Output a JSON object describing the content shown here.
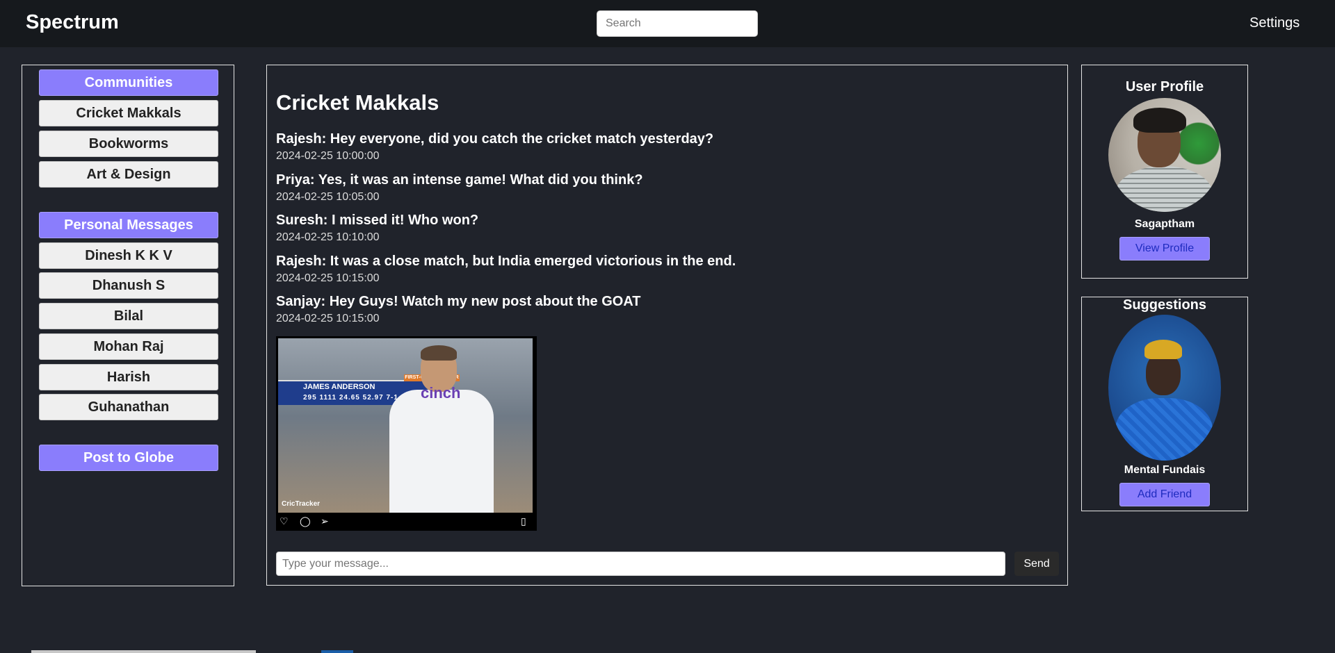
{
  "app": {
    "title": "Spectrum",
    "settings_label": "Settings"
  },
  "search": {
    "placeholder": "Search"
  },
  "sidebar": {
    "communities_label": "Communities",
    "communities": [
      "Cricket Makkals",
      "Bookworms",
      "Art & Design"
    ],
    "personal_label": "Personal Messages",
    "contacts": [
      "Dinesh K K V",
      "Dhanush S",
      "Bilal",
      "Mohan Raj",
      "Harish",
      "Guhanathan"
    ],
    "post_label": "Post to Globe"
  },
  "chat": {
    "title": "Cricket Makkals",
    "messages": [
      {
        "text": "Rajesh: Hey everyone, did you catch the cricket match yesterday?",
        "time": "2024-02-25 10:00:00"
      },
      {
        "text": "Priya: Yes, it was an intense game! What did you think?",
        "time": "2024-02-25 10:05:00"
      },
      {
        "text": "Suresh: I missed it! Who won?",
        "time": "2024-02-25 10:10:00"
      },
      {
        "text": "Rajesh: It was a close match, but India emerged victorious in the end.",
        "time": "2024-02-25 10:15:00"
      },
      {
        "text": "Sanjay: Hey Guys! Watch my new post about the GOAT",
        "time": "2024-02-25 10:15:00"
      }
    ],
    "post_image": {
      "scoreboard_name": "JAMES ANDERSON",
      "scoreboard_tag": "FIRST-CLASS CAREER",
      "scoreboard_stats": "295 1111 24.65 52.97 7-1",
      "jersey_logo": "cinch",
      "watermark": "CricTracker"
    },
    "input_placeholder": "Type your message...",
    "send_label": "Send"
  },
  "profile": {
    "title": "User Profile",
    "name": "Sagaptham",
    "button": "View Profile"
  },
  "suggestions": {
    "title": "Suggestions",
    "name": "Mental Fundais",
    "button": "Add Friend"
  },
  "colors": {
    "accent": "#8a7dfc",
    "background": "#20232b",
    "topbar": "#16191d"
  }
}
